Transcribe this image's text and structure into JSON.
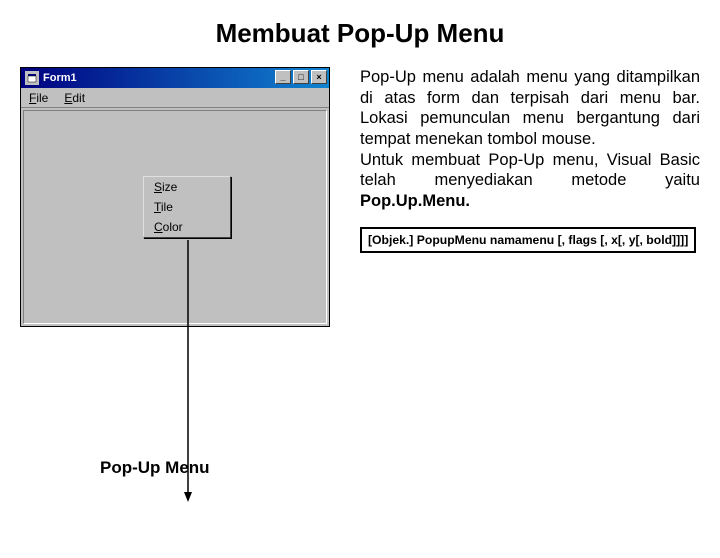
{
  "title": "Membuat Pop-Up Menu",
  "vb_window": {
    "title": "Form1",
    "buttons": {
      "min": "_",
      "max": "□",
      "close": "×"
    },
    "menubar": [
      {
        "raw": "File",
        "u": "F",
        "rest": "ile"
      },
      {
        "raw": "Edit",
        "u": "E",
        "rest": "dit"
      }
    ],
    "popup": [
      {
        "u": "S",
        "rest": "ize"
      },
      {
        "u": "T",
        "rest": "ile"
      },
      {
        "u": "C",
        "rest": "olor"
      }
    ]
  },
  "description": {
    "p1": "Pop-Up menu adalah menu yang ditampilkan di atas form dan terpisah dari menu bar. Lokasi pemunculan menu bergantung dari tempat menekan tombol mouse.",
    "p2a": "Untuk membuat Pop-Up menu, Visual Basic telah menyediakan metode yaitu ",
    "p2b": "Pop.Up.Menu."
  },
  "syntax": "[Objek.] PopupMenu namamenu [, flags [, x[, y[, bold]]]]",
  "bottom_label": "Pop-Up Menu"
}
